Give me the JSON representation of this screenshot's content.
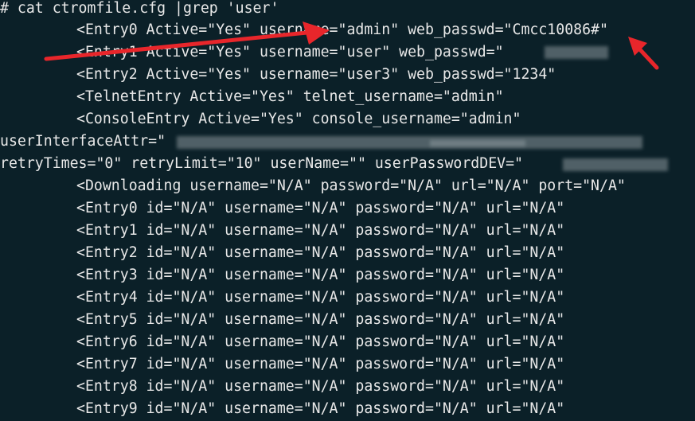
{
  "terminal": {
    "command": "# cat ctromfile.cfg |grep 'user'",
    "lines": [
      "<Entry0 Active=\"Yes\" username=\"admin\" web_passwd=\"Cmcc10086#\"",
      "<Entry1 Active=\"Yes\" username=\"user\" web_passwd=\"",
      "<Entry2 Active=\"Yes\" username=\"user3\" web_passwd=\"1234\"",
      "<TelnetEntry Active=\"Yes\" telnet_username=\"admin\"",
      "<ConsoleEntry Active=\"Yes\" console_username=\"admin\"",
      "userInterfaceAttr=\"",
      "retryTimes=\"0\" retryLimit=\"10\" userName=\"\" userPasswordDEV=\"",
      "<Downloading username=\"N/A\" password=\"N/A\" url=\"N/A\" port=\"N/A\"",
      "<Entry0 id=\"N/A\" username=\"N/A\" password=\"N/A\" url=\"N/A\"",
      "<Entry1 id=\"N/A\" username=\"N/A\" password=\"N/A\" url=\"N/A\"",
      "<Entry2 id=\"N/A\" username=\"N/A\" password=\"N/A\" url=\"N/A\"",
      "<Entry3 id=\"N/A\" username=\"N/A\" password=\"N/A\" url=\"N/A\"",
      "<Entry4 id=\"N/A\" username=\"N/A\" password=\"N/A\" url=\"N/A\"",
      "<Entry5 id=\"N/A\" username=\"N/A\" password=\"N/A\" url=\"N/A\"",
      "<Entry6 id=\"N/A\" username=\"N/A\" password=\"N/A\" url=\"N/A\"",
      "<Entry7 id=\"N/A\" username=\"N/A\" password=\"N/A\" url=\"N/A\"",
      "<Entry8 id=\"N/A\" username=\"N/A\" password=\"N/A\" url=\"N/A\"",
      "<Entry9 id=\"N/A\" username=\"N/A\" password=\"N/A\" url=\"N/A\""
    ]
  },
  "colors": {
    "background": "#0b2028",
    "text": "#e8e8e8",
    "annotation_arrow": "#e8262b"
  }
}
